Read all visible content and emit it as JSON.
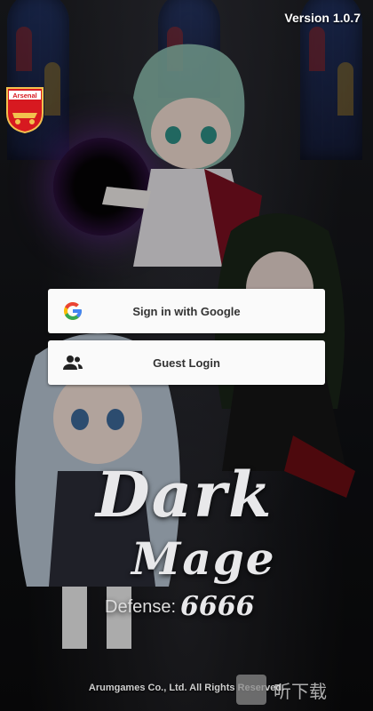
{
  "version_label": "Version 1.0.7",
  "crest": {
    "text": "Arsenal"
  },
  "login": {
    "google_label": "Sign in with Google",
    "guest_label": "Guest Login"
  },
  "logo": {
    "dark": "Dark",
    "mage": "Mage",
    "defense": "Defense:",
    "num": "6666"
  },
  "copyright": "Arumgames Co., Ltd. All Rights Reserved.",
  "watermark": {
    "text": "听下载"
  },
  "colors": {
    "button_bg": "#fafafa",
    "button_text": "#333333",
    "google_blue": "#4285F4",
    "google_red": "#EA4335",
    "google_yellow": "#FBBC05",
    "google_green": "#34A853"
  }
}
